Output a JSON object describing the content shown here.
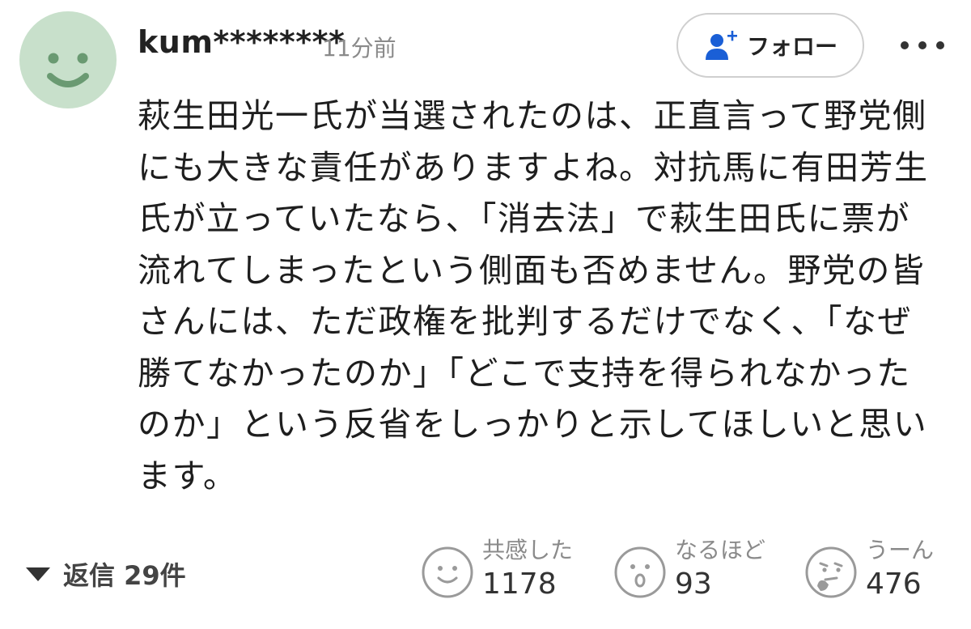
{
  "comment": {
    "author": "kum********",
    "posted": "11分前",
    "body": "萩生田光一氏が当選されたのは、正直言って野党側にも大きな責任がありますよね。対抗馬に有田芳生氏が立っていたなら、「消去法」で萩生田氏に票が流れてしまったという側面も否めません。野党の皆さんには、ただ政権を批判するだけでなく、「なぜ勝てなかったのか」「どこで支持を得られなかったのか」という反省をしっかりと示してほしいと思います。"
  },
  "follow_button": {
    "label": "フォロー",
    "icon": "add-user-icon",
    "color": "#1a5fd6"
  },
  "more_button": {
    "icon": "more-dots-icon"
  },
  "replies": {
    "label": "返信 29件",
    "icon": "triangle-down-icon"
  },
  "reactions": [
    {
      "label": "共感した",
      "count": "1178",
      "icon": "smile-face-icon"
    },
    {
      "label": "なるほど",
      "count": "93",
      "icon": "surprised-face-icon"
    },
    {
      "label": "うーん",
      "count": "476",
      "icon": "thinking-face-icon"
    }
  ],
  "colors": {
    "avatar_bg": "#c8e0cb",
    "avatar_face": "#6a9a72",
    "muted": "#8a8a8a"
  }
}
